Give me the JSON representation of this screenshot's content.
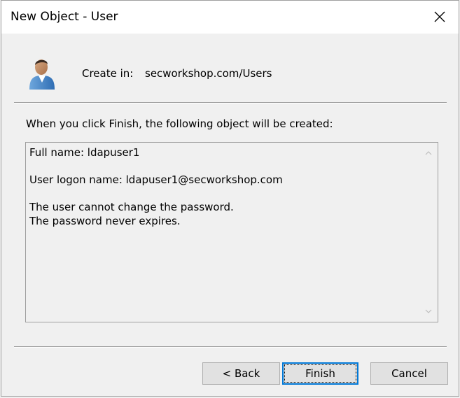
{
  "window": {
    "title": "New Object - User"
  },
  "header": {
    "create_in_label": "Create in:",
    "create_in_value": "secworkshop.com/Users"
  },
  "instruction": "When you click Finish, the following object will be created:",
  "summary": {
    "lines": [
      "Full name: ldapuser1",
      "",
      "User logon name: ldapuser1@secworkshop.com",
      "",
      "The user cannot change the password.",
      "The password never expires."
    ]
  },
  "buttons": {
    "back": "< Back",
    "finish": "Finish",
    "cancel": "Cancel"
  },
  "icons": {
    "close": "close-icon",
    "user": "user-icon",
    "scroll_up": "chevron-up-icon",
    "scroll_down": "chevron-down-icon"
  },
  "colors": {
    "accent": "#0078d7",
    "dialog_bg": "#f0f0f0",
    "button_bg": "#e1e1e1"
  }
}
